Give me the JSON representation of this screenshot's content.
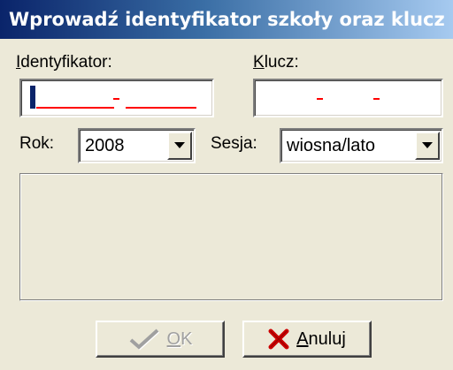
{
  "window": {
    "title": "Wprowadź identyfikator szkoły oraz klucz"
  },
  "form": {
    "identyfikator_label": "Identyfikator:",
    "klucz_label": "Klucz:",
    "rok_label": "Rok:",
    "rok_value": "2008",
    "sesja_label": "Sesja:",
    "sesja_value": "wiosna/lato"
  },
  "buttons": {
    "ok_label": "OK",
    "anuluj_label": "Anuluj"
  },
  "colors": {
    "mask_dashes": "#ff0000",
    "cancel_icon": "#cc0000",
    "title_gradient_start": "#0a246a",
    "title_gradient_end": "#a6caf0"
  },
  "icons": {
    "ok": "checkmark-icon",
    "cancel": "x-cross-icon",
    "dropdown": "chevron-down-icon"
  }
}
